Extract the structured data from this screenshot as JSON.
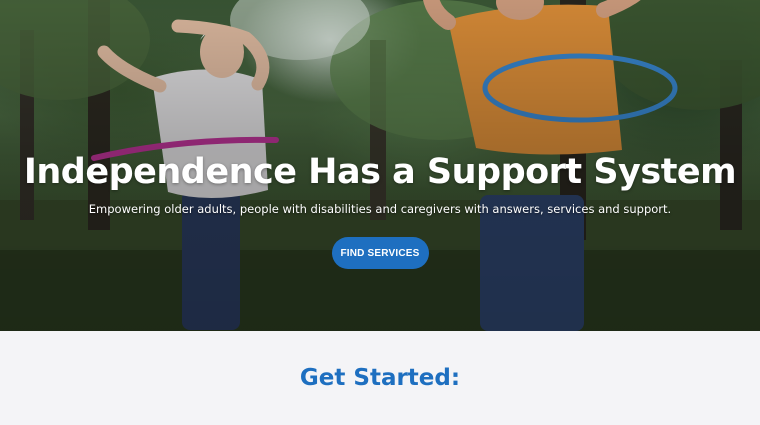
{
  "hero": {
    "title": "Independence Has a Support System",
    "subtitle": "Empowering older adults, people with disabilities and caregivers with answers, services and support.",
    "cta_label": "FIND SERVICES"
  },
  "get_started": {
    "title": "Get Started:"
  },
  "colors": {
    "accent": "#1e6fc0",
    "hero_text": "#ffffff",
    "section_background": "#f4f4f7"
  }
}
